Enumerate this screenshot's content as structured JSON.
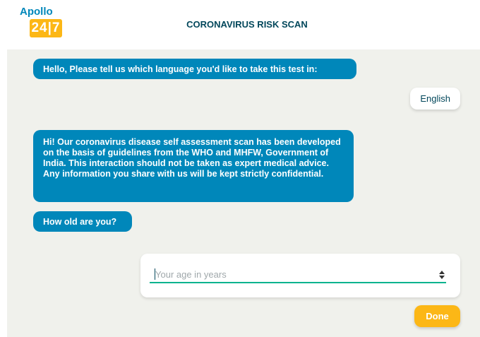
{
  "header": {
    "logo_top": "Apollo",
    "logo_bottom": "24|7",
    "title": "CORONAVIRUS RISK SCAN"
  },
  "chat": {
    "messages": [
      "Hello, Please tell us which language you'd like to take this test in:",
      "Hi! Our coronavirus disease self assessment scan has been developed on the basis of guidelines from the WHO and MHFW, Government of India. This interaction should not be taken as expert medical advice. Any information you share with us will be kept strictly confidential.",
      "How old are you?"
    ],
    "user_reply": "English"
  },
  "age_input": {
    "placeholder": "Your age in years",
    "value": ""
  },
  "done_label": "Done",
  "colors": {
    "bubble": "#0087ba",
    "accent": "#fcb716",
    "underline": "#00b38e",
    "title": "#02475b",
    "chat_bg": "#f0f1ec"
  }
}
